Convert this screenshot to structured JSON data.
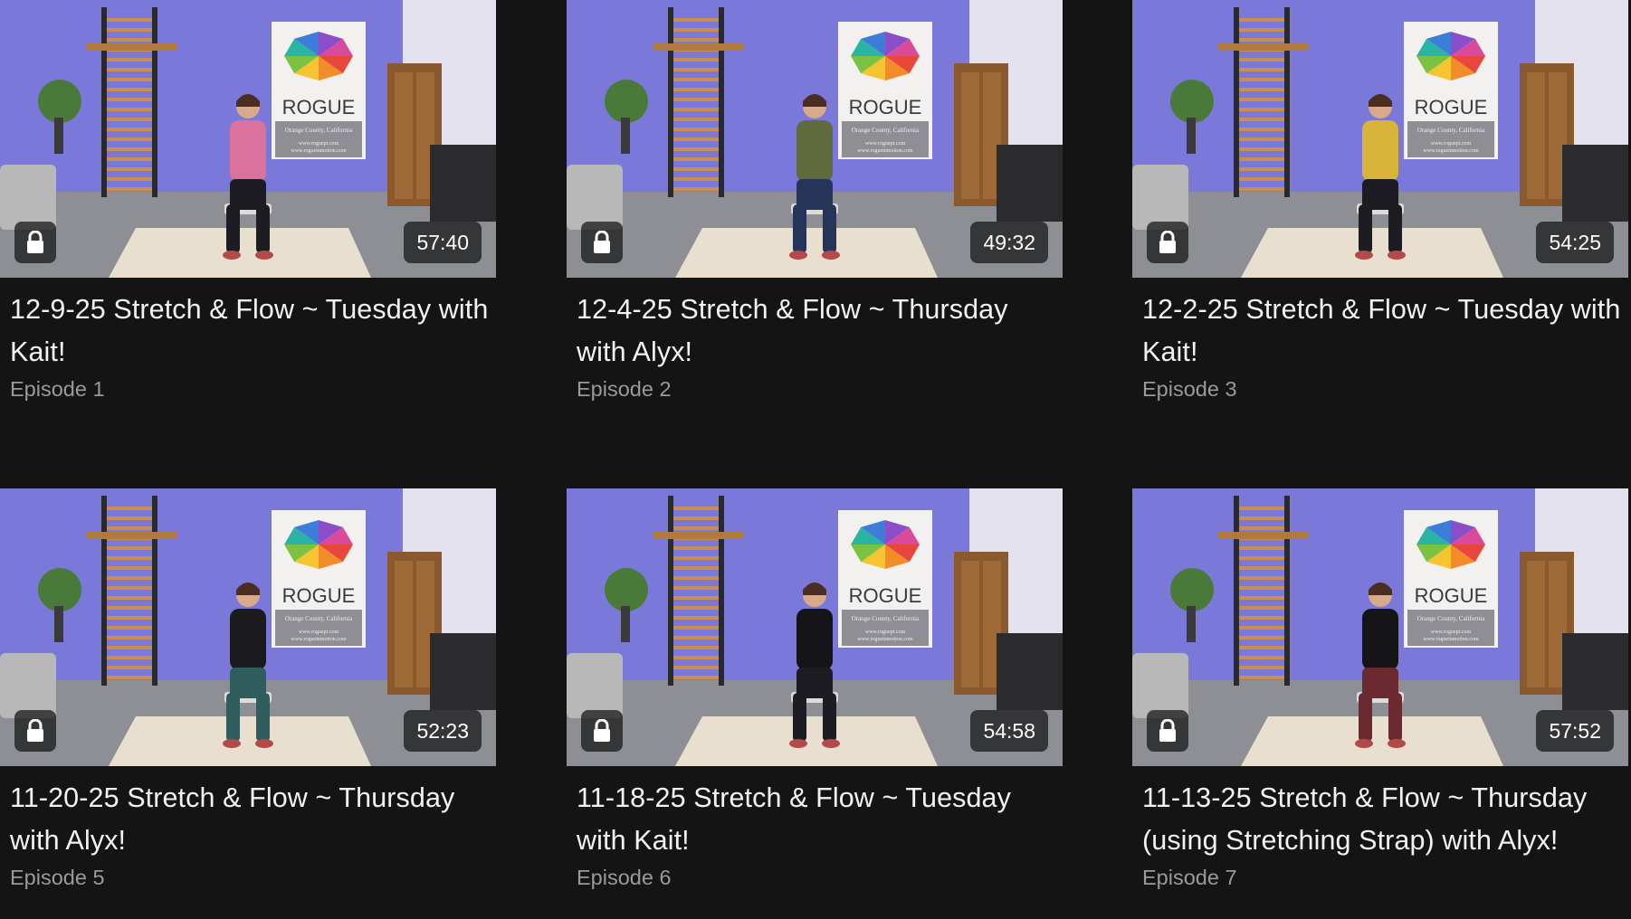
{
  "videos": [
    {
      "title": "12-9-25 Stretch & Flow ~ Tuesday with Kait!",
      "episode": "Episode 1",
      "duration": "57:40",
      "locked": true,
      "shirt_color": "#d9729c",
      "pants_color": "#1c1c22"
    },
    {
      "title": "12-4-25 Stretch & Flow ~ Thursday with Alyx!",
      "episode": "Episode 2",
      "duration": "49:32",
      "locked": true,
      "shirt_color": "#5f6b3c",
      "pants_color": "#27345a"
    },
    {
      "title": "12-2-25 Stretch & Flow ~ Tuesday with Kait!",
      "episode": "Episode 3",
      "duration": "54:25",
      "locked": true,
      "shirt_color": "#d8b43a",
      "pants_color": "#1c1c22"
    },
    {
      "title": "11-20-25 Stretch & Flow ~ Thursday with Alyx!",
      "episode": "Episode 5",
      "duration": "52:23",
      "locked": true,
      "shirt_color": "#1b1b1e",
      "pants_color": "#2f5c5c"
    },
    {
      "title": "11-18-25 Stretch & Flow ~ Tuesday with Kait!",
      "episode": "Episode 6",
      "duration": "54:58",
      "locked": true,
      "shirt_color": "#151518",
      "pants_color": "#1c1c22"
    },
    {
      "title": "11-13-25 Stretch & Flow ~ Thursday (using Stretching Strap) with Alyx!",
      "episode": "Episode 7",
      "duration": "57:52",
      "locked": true,
      "shirt_color": "#151518",
      "pants_color": "#6b2a30"
    }
  ],
  "poster": {
    "brand": "ROGUE",
    "location": "Orange County, California",
    "url1": "www.roguept.com",
    "url2": "www.rogueinmotion.com"
  },
  "icons": {
    "lock": "lock-icon"
  },
  "colors": {
    "background": "#141414",
    "title": "#f2f2f2",
    "episode": "#9a9a9a",
    "wall": "#7a78d8"
  }
}
